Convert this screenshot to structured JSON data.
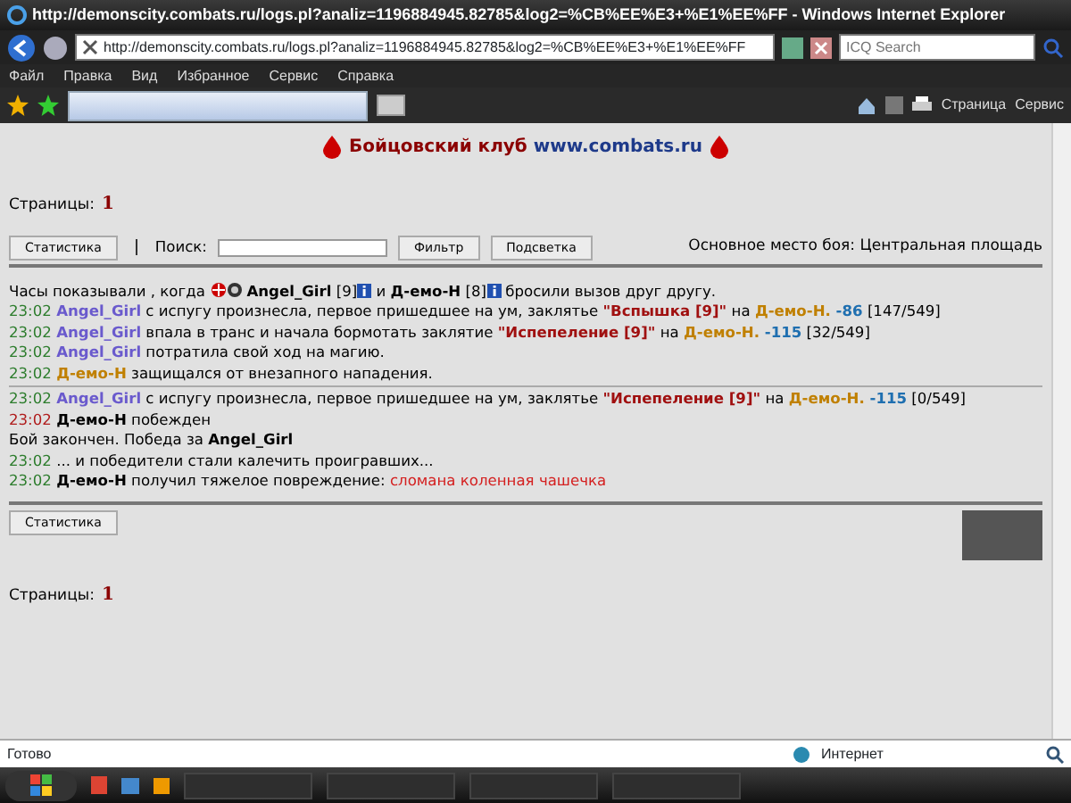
{
  "window": {
    "title": "http://demonscity.combats.ru/logs.pl?analiz=1196884945.82785&log2=%CB%EE%E3+%E1%EE%FF - Windows Internet Explorer"
  },
  "address_bar": {
    "value": "http://demonscity.combats.ru/logs.pl?analiz=1196884945.82785&log2=%CB%EE%E3+%E1%EE%FF"
  },
  "search_box": {
    "placeholder": "ICQ Search"
  },
  "menu": [
    "Файл",
    "Правка",
    "Вид",
    "Избранное",
    "Сервис",
    "Справка"
  ],
  "toolbar": {
    "buttons": [
      "Страница",
      "Сервис"
    ]
  },
  "page": {
    "title": {
      "name": "Бойцовский клуб",
      "site": "www.combats.ru"
    },
    "pages_top": {
      "label": "Страницы:",
      "current": "1"
    },
    "controls": {
      "stats_button": "Статистика",
      "search_label": "Поиск:",
      "filter_button": "Фильтр",
      "highlight_button": "Подсветка"
    },
    "location": "Основное место боя: Центральная площадь",
    "intro": [
      {
        "kind": "plain",
        "text": "Часы показывали , когда "
      },
      {
        "kind": "emblem"
      },
      {
        "kind": "bold",
        "text": "Angel_Girl"
      },
      {
        "kind": "plain",
        "text": " [9]"
      },
      {
        "kind": "info"
      },
      {
        "kind": "plain",
        "text": " и "
      },
      {
        "kind": "bold",
        "text": "Д-емо-Н"
      },
      {
        "kind": "plain",
        "text": " [8]"
      },
      {
        "kind": "info"
      },
      {
        "kind": "plain",
        "text": " бросили вызов друг другу."
      }
    ],
    "log_groups": [
      [
        [
          {
            "kind": "time",
            "text": "23:02"
          },
          {
            "kind": "player_a",
            "text": "Angel_Girl"
          },
          {
            "kind": "plain",
            "text": " с испугу произнесла, первое пришедшее на ум, заклятье "
          },
          {
            "kind": "spell",
            "text": "\"Вспышка [9]\""
          },
          {
            "kind": "plain",
            "text": " на "
          },
          {
            "kind": "player_b",
            "text": "Д-емо-Н."
          },
          {
            "kind": "damage",
            "text": " -86"
          },
          {
            "kind": "plain",
            "text": " [147/549]"
          }
        ],
        [
          {
            "kind": "time",
            "text": "23:02"
          },
          {
            "kind": "player_a",
            "text": "Angel_Girl"
          },
          {
            "kind": "plain",
            "text": " впала в транс и начала бормотать заклятие "
          },
          {
            "kind": "spell",
            "text": "\"Испепеление [9]\""
          },
          {
            "kind": "plain",
            "text": " на "
          },
          {
            "kind": "player_b",
            "text": "Д-емо-Н."
          },
          {
            "kind": "damage",
            "text": " -115"
          },
          {
            "kind": "plain",
            "text": " [32/549]"
          }
        ],
        [
          {
            "kind": "time",
            "text": "23:02"
          },
          {
            "kind": "player_a",
            "text": "Angel_Girl"
          },
          {
            "kind": "plain",
            "text": " потратила свой ход на магию."
          }
        ],
        [
          {
            "kind": "time",
            "text": "23:02"
          },
          {
            "kind": "player_b",
            "text": "Д-емо-Н"
          },
          {
            "kind": "plain",
            "text": " защищался от внезапного нападения."
          }
        ]
      ],
      [
        [
          {
            "kind": "time",
            "text": "23:02"
          },
          {
            "kind": "player_a",
            "text": "Angel_Girl"
          },
          {
            "kind": "plain",
            "text": " с испугу произнесла, первое пришедшее на ум, заклятье "
          },
          {
            "kind": "spell",
            "text": "\"Испепеление [9]\""
          },
          {
            "kind": "plain",
            "text": " на "
          },
          {
            "kind": "player_b",
            "text": "Д-емо-Н."
          },
          {
            "kind": "damage",
            "text": " -115"
          },
          {
            "kind": "plain",
            "text": " [0/549]"
          }
        ],
        [
          {
            "kind": "time_alert",
            "text": "23:02"
          },
          {
            "kind": "bold",
            "text": "Д-емо-Н"
          },
          {
            "kind": "plain",
            "text": " побежден"
          }
        ],
        [
          {
            "kind": "plain",
            "text": "Бой закончен. Победа за "
          },
          {
            "kind": "bold",
            "text": "Angel_Girl"
          }
        ],
        [
          {
            "kind": "time",
            "text": "23:02"
          },
          {
            "kind": "plain",
            "text": " ... и победители стали калечить проигравших..."
          }
        ],
        [
          {
            "kind": "time",
            "text": "23:02"
          },
          {
            "kind": "bold",
            "text": "Д-емо-Н"
          },
          {
            "kind": "plain",
            "text": " получил тяжелое повреждение: "
          },
          {
            "kind": "injury",
            "text": "сломана коленная чашечка"
          }
        ]
      ]
    ],
    "bottom_stats_button": "Статистика",
    "pages_bottom": {
      "label": "Страницы:",
      "current": "1"
    }
  },
  "status_bar": {
    "text": "Готово",
    "zone": "Интернет"
  }
}
